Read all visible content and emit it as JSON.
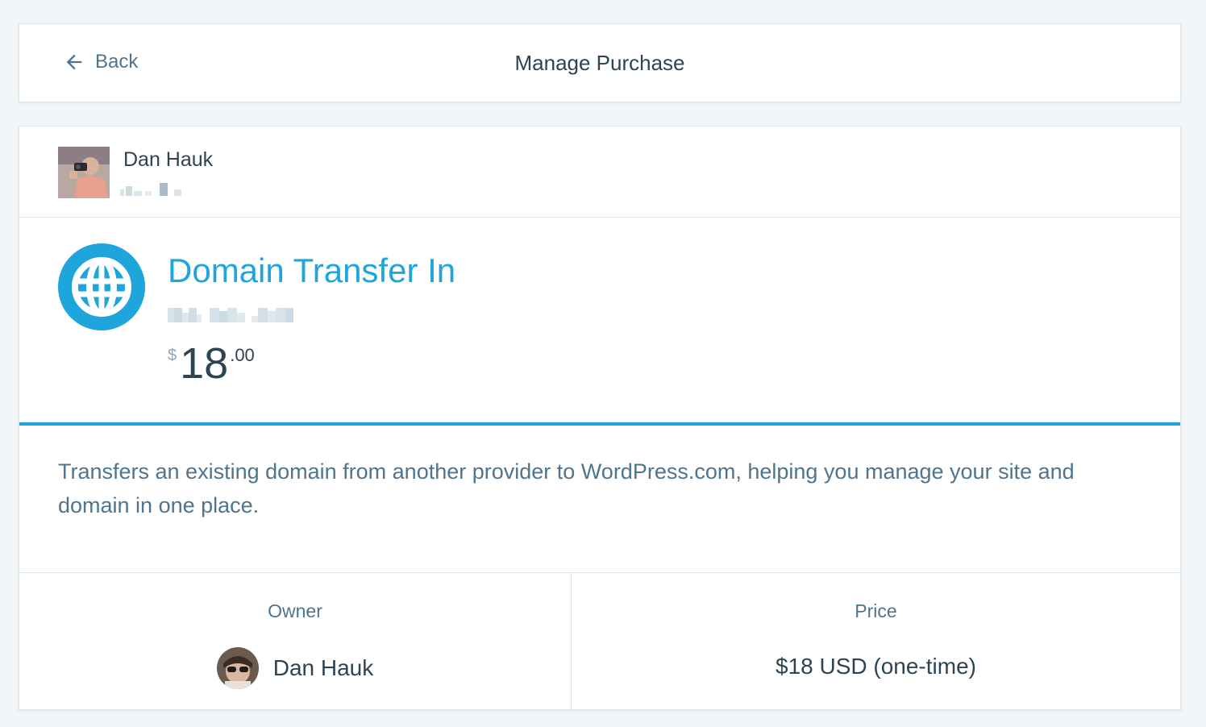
{
  "header": {
    "back_label": "Back",
    "title": "Manage Purchase"
  },
  "site": {
    "name": "Dan Hauk",
    "icon": "avatar-photo"
  },
  "product": {
    "icon": "globe-icon",
    "title": "Domain Transfer In",
    "price": {
      "currency": "$",
      "integer": "18",
      "fraction": ".00"
    }
  },
  "description": "Transfers an existing domain from another provider to WordPress.com, helping you manage your site and domain in one place.",
  "meta": {
    "owner_label": "Owner",
    "owner_name": "Dan Hauk",
    "price_label": "Price",
    "price_value": "$18 USD (one-time)"
  },
  "colors": {
    "accent": "#1ea6dc",
    "text": "#2e4453",
    "muted": "#4f748e",
    "border": "#dde4ea",
    "background": "#f3f6f8"
  }
}
